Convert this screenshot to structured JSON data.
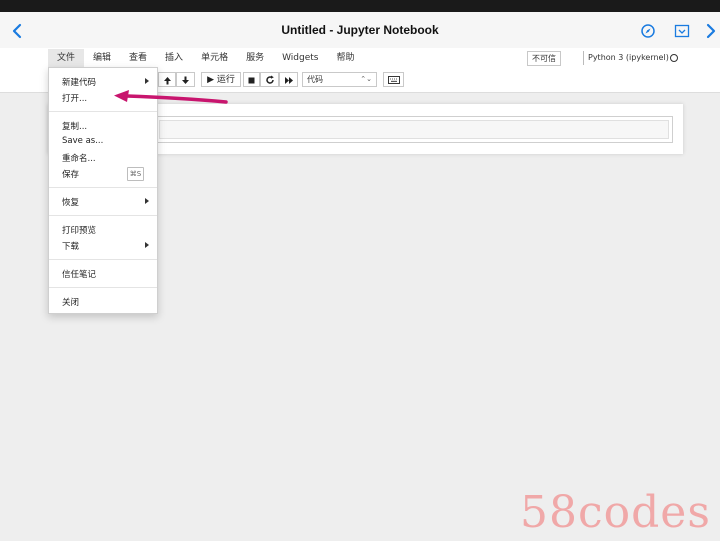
{
  "window": {
    "title": "Untitled - Jupyter Notebook"
  },
  "menubar": {
    "items": [
      "文件",
      "编辑",
      "查看",
      "插入",
      "单元格",
      "服务",
      "Widgets",
      "帮助"
    ],
    "trust_label": "不可信",
    "kernel_label": "Python 3 (ipykernel)"
  },
  "toolbar": {
    "run_label": "▶ 运行",
    "cell_type": "代码"
  },
  "file_menu": {
    "items": [
      {
        "label": "新建代码",
        "has_submenu": true
      },
      {
        "label": "打开...",
        "has_submenu": false
      },
      {
        "label": "复制...",
        "has_submenu": false
      },
      {
        "label": "Save as...",
        "has_submenu": false
      },
      {
        "label": "重命名...",
        "has_submenu": false
      },
      {
        "label": "保存",
        "has_submenu": false,
        "shortcut": "⌘S"
      },
      {
        "label": "恢复",
        "has_submenu": true
      },
      {
        "label": "打印预览",
        "has_submenu": false
      },
      {
        "label": "下载",
        "has_submenu": true
      },
      {
        "label": "信任笔记",
        "has_submenu": false
      },
      {
        "label": "关闭",
        "has_submenu": false
      }
    ]
  },
  "watermark": "58codes",
  "colors": {
    "accent_blue": "#1a7be0",
    "annotation_arrow": "#c8156e",
    "watermark": "#f0a8a8"
  }
}
